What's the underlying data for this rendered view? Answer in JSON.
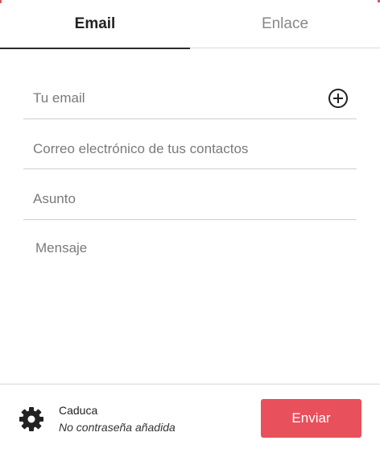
{
  "tabs": {
    "email_label": "Email",
    "link_label": "Enlace"
  },
  "form": {
    "your_email_placeholder": "Tu email",
    "contacts_placeholder": "Correo electrónico de tus contactos",
    "subject_placeholder": "Asunto",
    "message_placeholder": "Mensaje",
    "add_icon": "plus-circle-icon"
  },
  "footer": {
    "settings_icon": "gear-icon",
    "expire_label": "Caduca",
    "expire_value": "",
    "password_note": "No contraseña añadida",
    "send_label": "Enviar"
  },
  "colors": {
    "accent": "#e8505b",
    "active_tab": "#222222",
    "inactive_tab": "#888888"
  }
}
